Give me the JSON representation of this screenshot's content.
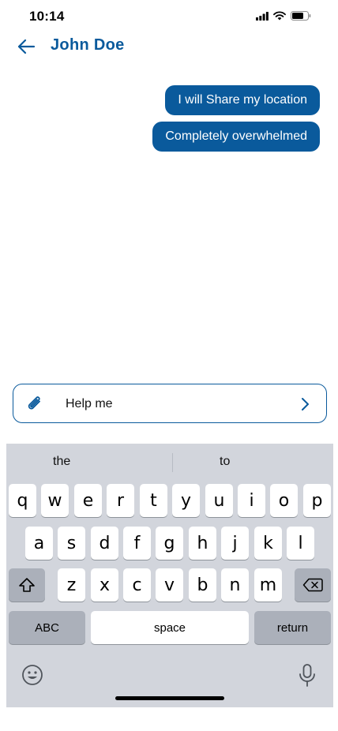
{
  "status": {
    "time": "10:14"
  },
  "header": {
    "contact_name": "John Doe"
  },
  "messages": [
    {
      "text": "I will Share my location"
    },
    {
      "text": "Completely overwhelmed"
    }
  ],
  "composer": {
    "value": "Help me"
  },
  "keyboard": {
    "suggestions": [
      "the",
      "to"
    ],
    "row1": [
      "q",
      "w",
      "e",
      "r",
      "t",
      "y",
      "u",
      "i",
      "o",
      "p"
    ],
    "row2": [
      "a",
      "s",
      "d",
      "f",
      "g",
      "h",
      "j",
      "k",
      "l"
    ],
    "row3": [
      "z",
      "x",
      "c",
      "v",
      "b",
      "n",
      "m"
    ],
    "abc_label": "ABC",
    "space_label": "space",
    "return_label": "return"
  },
  "colors": {
    "accent": "#0a5a9c",
    "keyboard_bg": "#d2d5dc",
    "dark_key": "#abb0ba"
  }
}
